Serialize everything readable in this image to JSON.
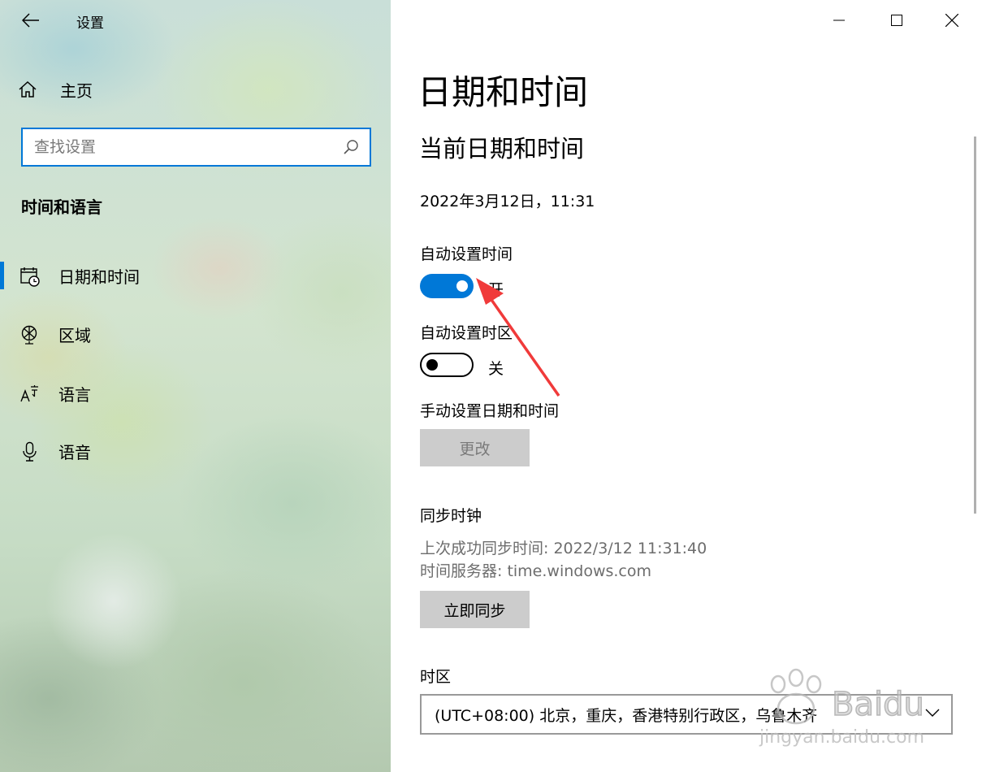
{
  "app": {
    "title": "设置"
  },
  "sidebar": {
    "home_label": "主页",
    "search_placeholder": "查找设置",
    "section_title": "时间和语言",
    "items": [
      {
        "label": "日期和时间",
        "icon": "calendar-clock-icon",
        "selected": true
      },
      {
        "label": "区域",
        "icon": "globe-icon",
        "selected": false
      },
      {
        "label": "语言",
        "icon": "language-icon",
        "selected": false
      },
      {
        "label": "语音",
        "icon": "microphone-icon",
        "selected": false
      }
    ]
  },
  "main": {
    "page_title": "日期和时间",
    "subheading": "当前日期和时间",
    "current_datetime": "2022年3月12日，11:31",
    "auto_time": {
      "label": "自动设置时间",
      "state": "开",
      "on": true
    },
    "auto_timezone": {
      "label": "自动设置时区",
      "state": "关",
      "on": false
    },
    "manual": {
      "label": "手动设置日期和时间",
      "button": "更改"
    },
    "sync": {
      "heading": "同步时钟",
      "last_sync": "上次成功同步时间: 2022/3/12 11:31:40",
      "server": "时间服务器: time.windows.com",
      "button": "立即同步"
    },
    "timezone": {
      "label": "时区",
      "value": "(UTC+08:00) 北京，重庆，香港特别行政区，乌鲁木齐"
    }
  },
  "colors": {
    "accent": "#0078d7",
    "annotation_arrow": "#f03a3a"
  },
  "watermark": {
    "text": "jingyan.baidu.com"
  }
}
